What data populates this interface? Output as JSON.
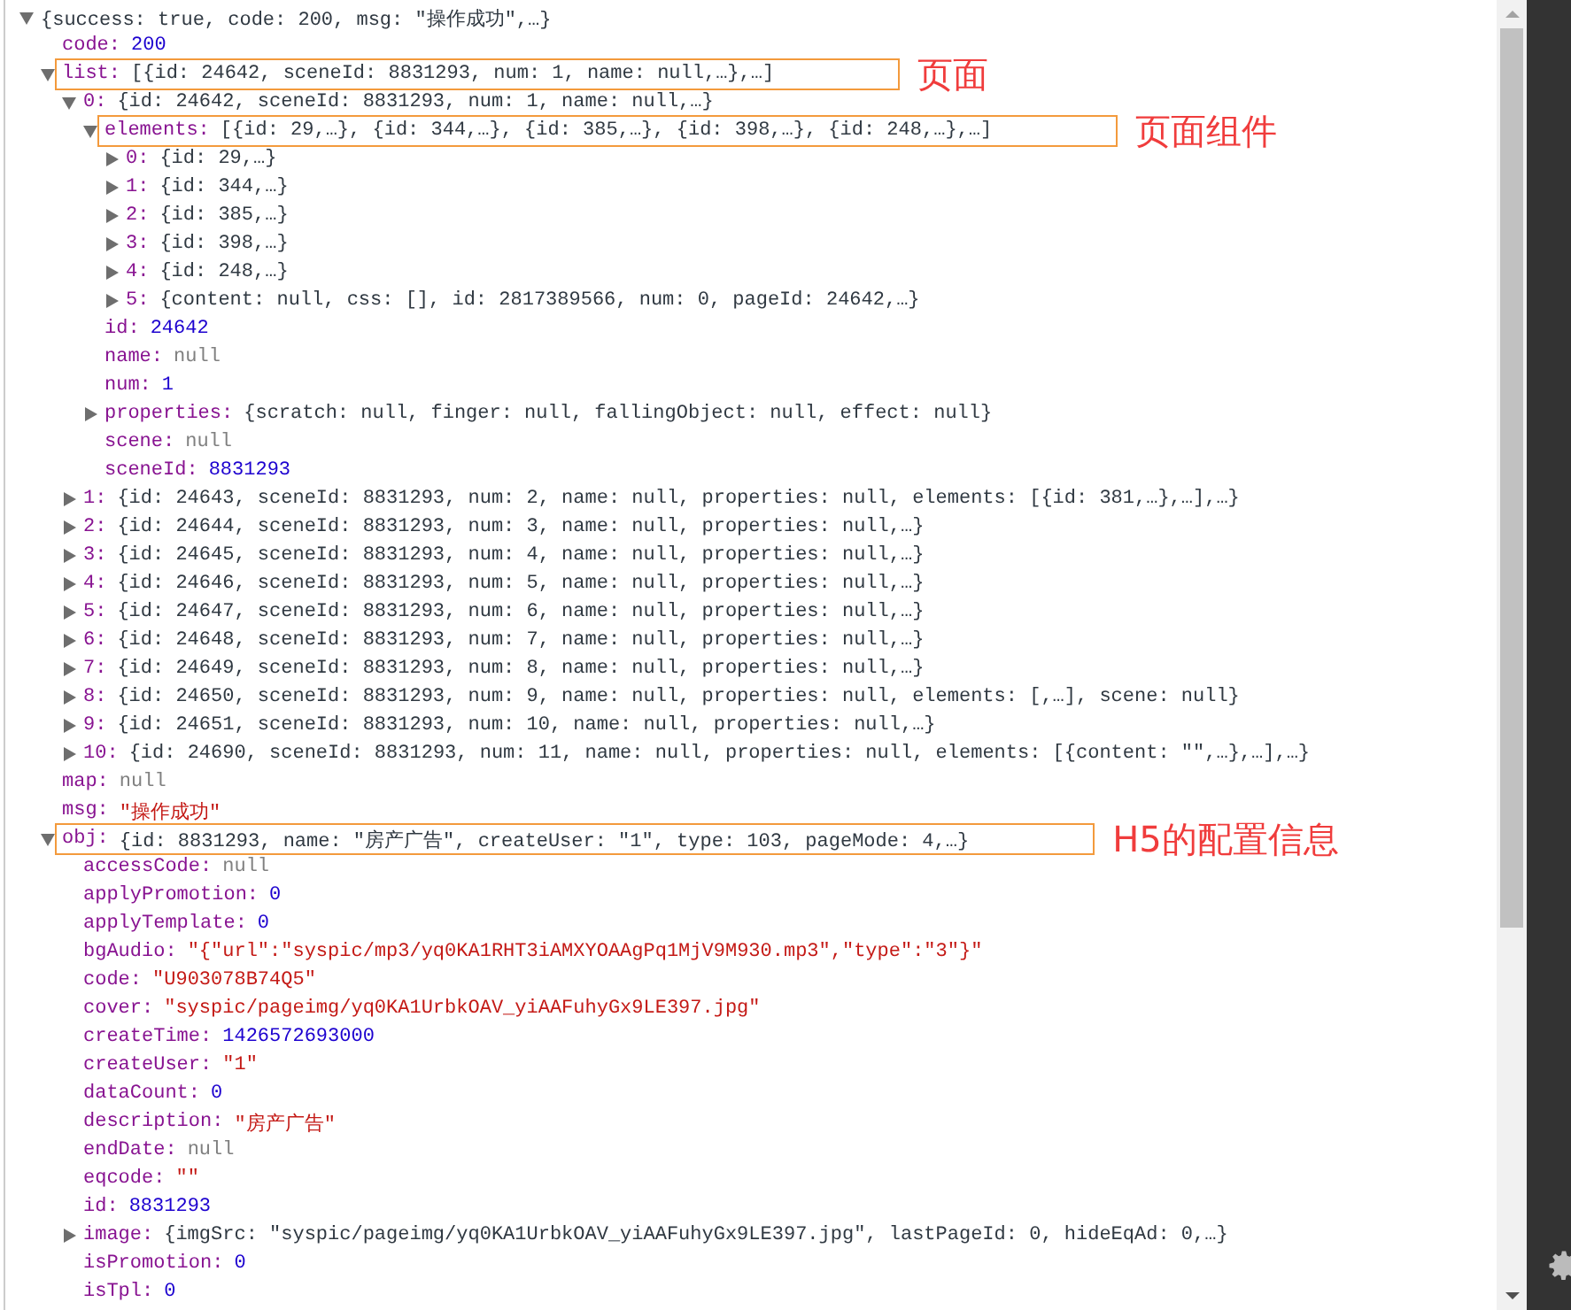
{
  "tree": {
    "value": "{success: true, code: 200, msg: \"操作成功\",…}",
    "kind": "preview",
    "expanded": true,
    "children": [
      {
        "key": "code:",
        "value": "200",
        "kind": "number"
      },
      {
        "key": "list:",
        "value": "[{id: 24642, sceneId: 8831293, num: 1, name: null,…},…]",
        "kind": "preview",
        "expanded": true,
        "annotation": "页面",
        "children": [
          {
            "key": "0:",
            "value": "{id: 24642, sceneId: 8831293, num: 1, name: null,…}",
            "kind": "preview",
            "expanded": true,
            "children": [
              {
                "key": "elements:",
                "value": "[{id: 29,…}, {id: 344,…}, {id: 385,…}, {id: 398,…}, {id: 248,…},…]",
                "kind": "preview",
                "expanded": true,
                "annotation": "页面组件",
                "children": [
                  {
                    "key": "0:",
                    "value": "{id: 29,…}",
                    "kind": "preview",
                    "expanded": false
                  },
                  {
                    "key": "1:",
                    "value": "{id: 344,…}",
                    "kind": "preview",
                    "expanded": false
                  },
                  {
                    "key": "2:",
                    "value": "{id: 385,…}",
                    "kind": "preview",
                    "expanded": false
                  },
                  {
                    "key": "3:",
                    "value": "{id: 398,…}",
                    "kind": "preview",
                    "expanded": false
                  },
                  {
                    "key": "4:",
                    "value": "{id: 248,…}",
                    "kind": "preview",
                    "expanded": false
                  },
                  {
                    "key": "5:",
                    "value": "{content: null, css: [], id: 2817389566, num: 0, pageId: 24642,…}",
                    "kind": "preview",
                    "expanded": false
                  }
                ]
              },
              {
                "key": "id:",
                "value": "24642",
                "kind": "number"
              },
              {
                "key": "name:",
                "value": "null",
                "kind": "null"
              },
              {
                "key": "num:",
                "value": "1",
                "kind": "number"
              },
              {
                "key": "properties:",
                "value": "{scratch: null, finger: null, fallingObject: null, effect: null}",
                "kind": "preview",
                "expanded": false
              },
              {
                "key": "scene:",
                "value": "null",
                "kind": "null"
              },
              {
                "key": "sceneId:",
                "value": "8831293",
                "kind": "number"
              }
            ]
          },
          {
            "key": "1:",
            "value": "{id: 24643, sceneId: 8831293, num: 2, name: null, properties: null, elements: [{id: 381,…},…],…}",
            "kind": "preview",
            "expanded": false
          },
          {
            "key": "2:",
            "value": "{id: 24644, sceneId: 8831293, num: 3, name: null, properties: null,…}",
            "kind": "preview",
            "expanded": false
          },
          {
            "key": "3:",
            "value": "{id: 24645, sceneId: 8831293, num: 4, name: null, properties: null,…}",
            "kind": "preview",
            "expanded": false
          },
          {
            "key": "4:",
            "value": "{id: 24646, sceneId: 8831293, num: 5, name: null, properties: null,…}",
            "kind": "preview",
            "expanded": false
          },
          {
            "key": "5:",
            "value": "{id: 24647, sceneId: 8831293, num: 6, name: null, properties: null,…}",
            "kind": "preview",
            "expanded": false
          },
          {
            "key": "6:",
            "value": "{id: 24648, sceneId: 8831293, num: 7, name: null, properties: null,…}",
            "kind": "preview",
            "expanded": false
          },
          {
            "key": "7:",
            "value": "{id: 24649, sceneId: 8831293, num: 8, name: null, properties: null,…}",
            "kind": "preview",
            "expanded": false
          },
          {
            "key": "8:",
            "value": "{id: 24650, sceneId: 8831293, num: 9, name: null, properties: null, elements: [,…], scene: null}",
            "kind": "preview",
            "expanded": false
          },
          {
            "key": "9:",
            "value": "{id: 24651, sceneId: 8831293, num: 10, name: null, properties: null,…}",
            "kind": "preview",
            "expanded": false
          },
          {
            "key": "10:",
            "value": "{id: 24690, sceneId: 8831293, num: 11, name: null, properties: null, elements: [{content: \"\",…},…],…}",
            "kind": "preview",
            "expanded": false
          }
        ]
      },
      {
        "key": "map:",
        "value": "null",
        "kind": "null"
      },
      {
        "key": "msg:",
        "value": "\"操作成功\"",
        "kind": "string"
      },
      {
        "key": "obj:",
        "value": "{id: 8831293, name: \"房产广告\", createUser: \"1\", type: 103, pageMode: 4,…}",
        "kind": "preview",
        "expanded": true,
        "annotation": "H5的配置信息",
        "children": [
          {
            "key": "accessCode:",
            "value": "null",
            "kind": "null"
          },
          {
            "key": "applyPromotion:",
            "value": "0",
            "kind": "number"
          },
          {
            "key": "applyTemplate:",
            "value": "0",
            "kind": "number"
          },
          {
            "key": "bgAudio:",
            "value": "\"{\"url\":\"syspic/mp3/yq0KA1RHT3iAMXYOAAgPq1MjV9M930.mp3\",\"type\":\"3\"}\"",
            "kind": "string"
          },
          {
            "key": "code:",
            "value": "\"U903078B74Q5\"",
            "kind": "string"
          },
          {
            "key": "cover:",
            "value": "\"syspic/pageimg/yq0KA1UrbkOAV_yiAAFuhyGx9LE397.jpg\"",
            "kind": "string"
          },
          {
            "key": "createTime:",
            "value": "1426572693000",
            "kind": "number"
          },
          {
            "key": "createUser:",
            "value": "\"1\"",
            "kind": "string"
          },
          {
            "key": "dataCount:",
            "value": "0",
            "kind": "number"
          },
          {
            "key": "description:",
            "value": "\"房产广告\"",
            "kind": "string"
          },
          {
            "key": "endDate:",
            "value": "null",
            "kind": "null"
          },
          {
            "key": "eqcode:",
            "value": "\"\"",
            "kind": "string"
          },
          {
            "key": "id:",
            "value": "8831293",
            "kind": "number"
          },
          {
            "key": "image:",
            "value": "{imgSrc: \"syspic/pageimg/yq0KA1UrbkOAV_yiAAFuhyGx9LE397.jpg\", lastPageId: 0, hideEqAd: 0,…}",
            "kind": "preview",
            "expanded": false
          },
          {
            "key": "isPromotion:",
            "value": "0",
            "kind": "number"
          },
          {
            "key": "isTpl:",
            "value": "0",
            "kind": "number"
          }
        ]
      }
    ]
  }
}
